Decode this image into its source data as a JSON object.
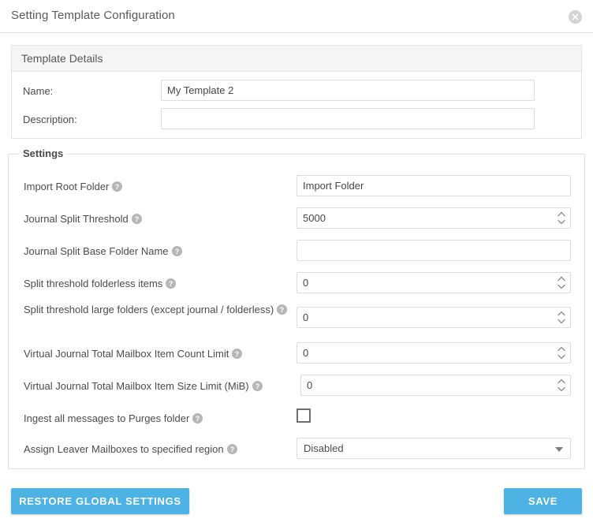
{
  "dialog": {
    "title": "Setting Template Configuration",
    "close_icon": "close-icon"
  },
  "template_details": {
    "panel_title": "Template Details",
    "fields": [
      {
        "label": "Name:",
        "value": "My Template 2",
        "placeholder": ""
      },
      {
        "label": "Description:",
        "value": "",
        "placeholder": ""
      }
    ]
  },
  "settings": {
    "legend": "Settings",
    "rows": [
      {
        "label": "Import Root Folder",
        "help_icon": "help-icon",
        "control": "text",
        "value": "Import Folder"
      },
      {
        "label": "Journal Split Threshold",
        "help_icon": "help-icon",
        "control": "number",
        "value": "5000"
      },
      {
        "label": "Journal Split Base Folder Name",
        "help_icon": "help-icon",
        "control": "text",
        "value": ""
      },
      {
        "label": "Split threshold folderless items",
        "help_icon": "help-icon",
        "control": "number",
        "value": "0"
      },
      {
        "label": "Split threshold large folders (except journal / folderless)",
        "help_icon": "help-icon",
        "control": "number",
        "value": "0"
      },
      {
        "label": "Virtual Journal Total Mailbox Item Count Limit",
        "help_icon": "help-icon",
        "control": "number",
        "value": "0"
      },
      {
        "label": "Virtual Journal Total Mailbox Item Size Limit (MiB)",
        "help_icon": "help-icon",
        "control": "number",
        "value": "0"
      },
      {
        "label": "Ingest all messages to Purges folder",
        "help_icon": "help-icon",
        "control": "checkbox",
        "checked": false
      },
      {
        "label": "Assign Leaver Mailboxes to specified region",
        "help_icon": "help-icon",
        "control": "select",
        "value": "Disabled"
      }
    ]
  },
  "footer": {
    "restore_label": "RESTORE GLOBAL SETTINGS",
    "save_label": "SAVE"
  },
  "colors": {
    "accent": "#4db3e4",
    "panel_header": "#f5f5f5",
    "border": "#e0e0e0",
    "label_text": "#4c4c4c",
    "help_icon": "#b6b6b6"
  }
}
